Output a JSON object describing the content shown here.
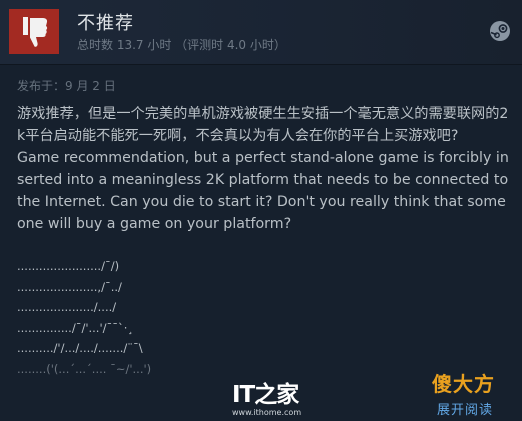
{
  "review": {
    "verdict": "不推荐",
    "hours": "总时数 13.7 小时 （评测时 4.0 小时）",
    "posted": "发布于：9 月 2 日",
    "body": "游戏推荐，但是一个完美的单机游戏被硬生生安插一个毫无意义的需要联网的2k平台启动能不能死一死啊，不会真以为有人会在你的平台上买游戏吧?\nGame recommendation, but a perfect stand-alone game is forcibly inserted into a meaningless 2K platform that needs to be connected to the Internet. Can you die to start it? Don't you really think that someone will buy a game on your platform?",
    "ascii": [
      "......................./¯/)",
      "......................,/¯../",
      "...................../..../",
      ".............../¯/'...'/¯¯`·¸",
      "........../'/.../..../......./¨¯\\",
      "........('(...´...´.... ¯~/'...')"
    ]
  },
  "icons": {
    "thumb": "thumbs-down-icon",
    "platform": "steam-icon"
  },
  "colors": {
    "thumb_bg": "#a32a22",
    "link": "#62a8e6",
    "background": "#16202d"
  },
  "actions": {
    "expand": "展开阅读"
  },
  "watermark": {
    "logo": "IT之家",
    "url": "www.ithome.com"
  },
  "brand": {
    "name": "傻大方"
  }
}
